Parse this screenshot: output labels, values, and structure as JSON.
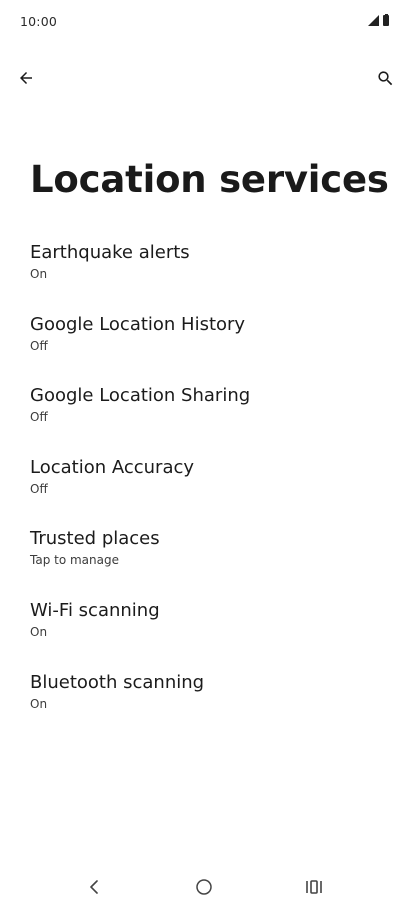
{
  "status_bar": {
    "time": "10:00",
    "icons": [
      "signal-icon",
      "battery-icon"
    ]
  },
  "app_bar": {
    "back_icon": "arrow-back-icon",
    "search_icon": "search-icon"
  },
  "page": {
    "title": "Location services"
  },
  "settings": {
    "items": [
      {
        "title": "Earthquake alerts",
        "summary": "On"
      },
      {
        "title": "Google Location History",
        "summary": "Off"
      },
      {
        "title": "Google Location Sharing",
        "summary": "Off"
      },
      {
        "title": "Location Accuracy",
        "summary": "Off"
      },
      {
        "title": "Trusted places",
        "summary": "Tap to manage"
      },
      {
        "title": "Wi-Fi scanning",
        "summary": "On"
      },
      {
        "title": "Bluetooth scanning",
        "summary": "On"
      }
    ]
  },
  "nav_bar": {
    "icons": [
      "nav-back-icon",
      "nav-home-icon",
      "nav-recents-icon"
    ]
  },
  "colors": {
    "background": "#ffffff",
    "text_primary": "#1b1b1b",
    "text_secondary": "#3c3c3c"
  }
}
